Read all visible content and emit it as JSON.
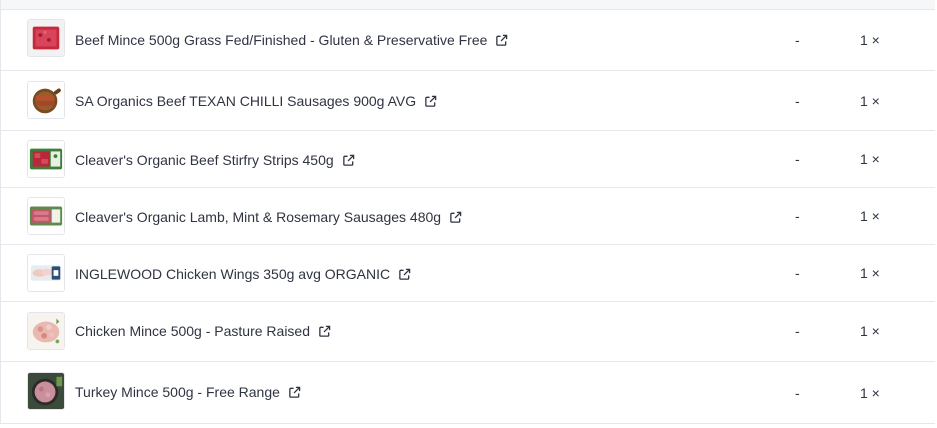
{
  "items": [
    {
      "name": "Beef Mince 500g Grass Fed/Finished - Gluten & Preservative Free",
      "price": "-",
      "qty": "1 ×",
      "image": "beef-mince"
    },
    {
      "name": "SA Organics Beef TEXAN CHILLI Sausages 900g AVG",
      "price": "-",
      "qty": "1 ×",
      "image": "sausages-board"
    },
    {
      "name": "Cleaver's Organic Beef Stirfry Strips 450g",
      "price": "-",
      "qty": "1 ×",
      "image": "beef-strips-pack"
    },
    {
      "name": "Cleaver's Organic Lamb, Mint & Rosemary Sausages 480g",
      "price": "-",
      "qty": "1 ×",
      "image": "lamb-sausage-pack"
    },
    {
      "name": "INGLEWOOD Chicken Wings 350g avg ORGANIC",
      "price": "-",
      "qty": "1 ×",
      "image": "chicken-wings-pack"
    },
    {
      "name": "Chicken Mince 500g - Pasture Raised",
      "price": "-",
      "qty": "1 ×",
      "image": "chicken-mince"
    },
    {
      "name": "Turkey Mince 500g - Free Range",
      "price": "-",
      "qty": "1 ×",
      "image": "turkey-mince-pan"
    }
  ],
  "icons": {
    "external_link": "external-link-icon"
  },
  "colors": {
    "text": "#2f3441",
    "border": "#e6e8ec",
    "header": "#f6f7f9"
  }
}
